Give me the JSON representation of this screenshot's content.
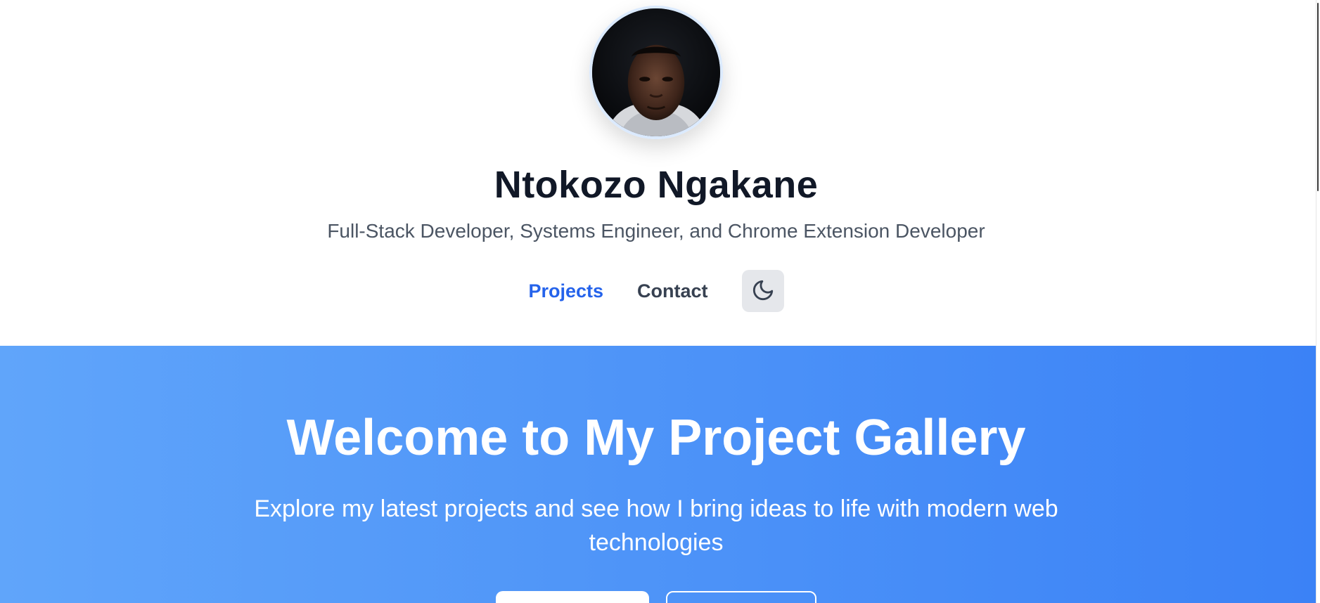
{
  "header": {
    "name": "Ntokozo Ngakane",
    "tagline": "Full-Stack Developer, Systems Engineer, and Chrome Extension Developer",
    "avatar_icon": "profile-photo",
    "nav": [
      {
        "label": "Projects",
        "active": true
      },
      {
        "label": "Contact",
        "active": false
      }
    ],
    "theme_toggle_icon": "moon-icon"
  },
  "hero": {
    "title": "Welcome to My Project Gallery",
    "subtitle": "Explore my latest projects and see how I bring ideas to life with modern web technologies"
  },
  "colors": {
    "accent": "#2563eb",
    "hero_gradient_start": "#60a5fa",
    "hero_gradient_end": "#3b82f6",
    "heading": "#111827"
  }
}
